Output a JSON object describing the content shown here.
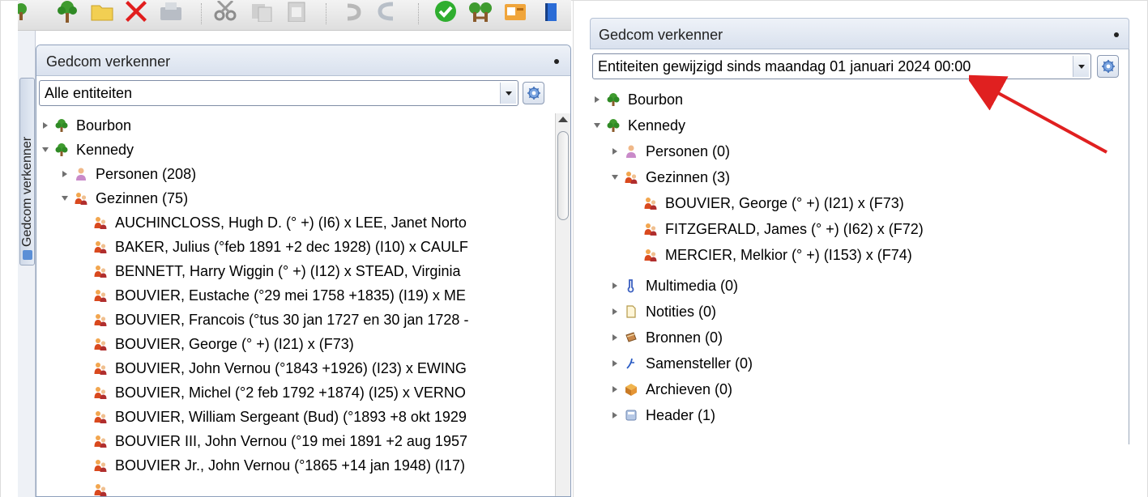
{
  "left": {
    "toolbar": {
      "icons": [
        "tree-add-icon",
        "folder-icon",
        "delete-icon",
        "save-icon",
        "cut-icon",
        "copy-icon",
        "paste-icon",
        "undo-icon",
        "redo-icon",
        "check-icon",
        "tree-icon",
        "id-card-icon",
        "book-icon"
      ]
    },
    "side_tab_label": "Gedcom verkenner",
    "panel": {
      "title": "Gedcom verkenner",
      "filter_value": "Alle entiteiten"
    },
    "tree": {
      "bourbon": "Bourbon",
      "kennedy": "Kennedy",
      "personen": "Personen (208)",
      "gezinnen": "Gezinnen (75)",
      "families": [
        "AUCHINCLOSS, Hugh D. (° +) (I6) x LEE, Janet Norto",
        "BAKER, Julius (°feb 1891 +2 dec 1928) (I10) x CAULF",
        "BENNETT, Harry Wiggin (° +) (I12) x STEAD, Virginia",
        "BOUVIER, Eustache (°29 mei 1758 +1835) (I19) x ME",
        "BOUVIER, Francois (°tus 30 jan 1727 en 30 jan 1728 -",
        "BOUVIER, George (° +) (I21) x  (F73)",
        "BOUVIER, John Vernou (°1843 +1926) (I23) x EWING",
        "BOUVIER, Michel (°2 feb 1792 +1874) (I25) x VERNO",
        "BOUVIER, William Sergeant (Bud) (°1893 +8 okt 1929",
        "BOUVIER III, John Vernou (°19 mei 1891 +2 aug 1957",
        "BOUVIER Jr., John Vernou (°1865 +14 jan 1948) (I17)"
      ]
    }
  },
  "right": {
    "panel": {
      "title": "Gedcom verkenner",
      "filter_value": "Entiteiten gewijzigd sinds maandag 01 januari 2024 00:00"
    },
    "tree": {
      "bourbon": "Bourbon",
      "kennedy": "Kennedy",
      "personen": "Personen (0)",
      "gezinnen": "Gezinnen (3)",
      "families": [
        "BOUVIER, George (° +) (I21) x  (F73)",
        "FITZGERALD, James (° +) (I62) x  (F72)",
        "MERCIER, Melkior (° +) (I153) x  (F74)"
      ],
      "multimedia": "Multimedia (0)",
      "notities": "Notities (0)",
      "bronnen": "Bronnen (0)",
      "samensteller": "Samensteller (0)",
      "archieven": "Archieven (0)",
      "header": "Header (1)"
    },
    "highlight_color": "#ffff00",
    "annotation_arrow_color": "#e02020"
  }
}
